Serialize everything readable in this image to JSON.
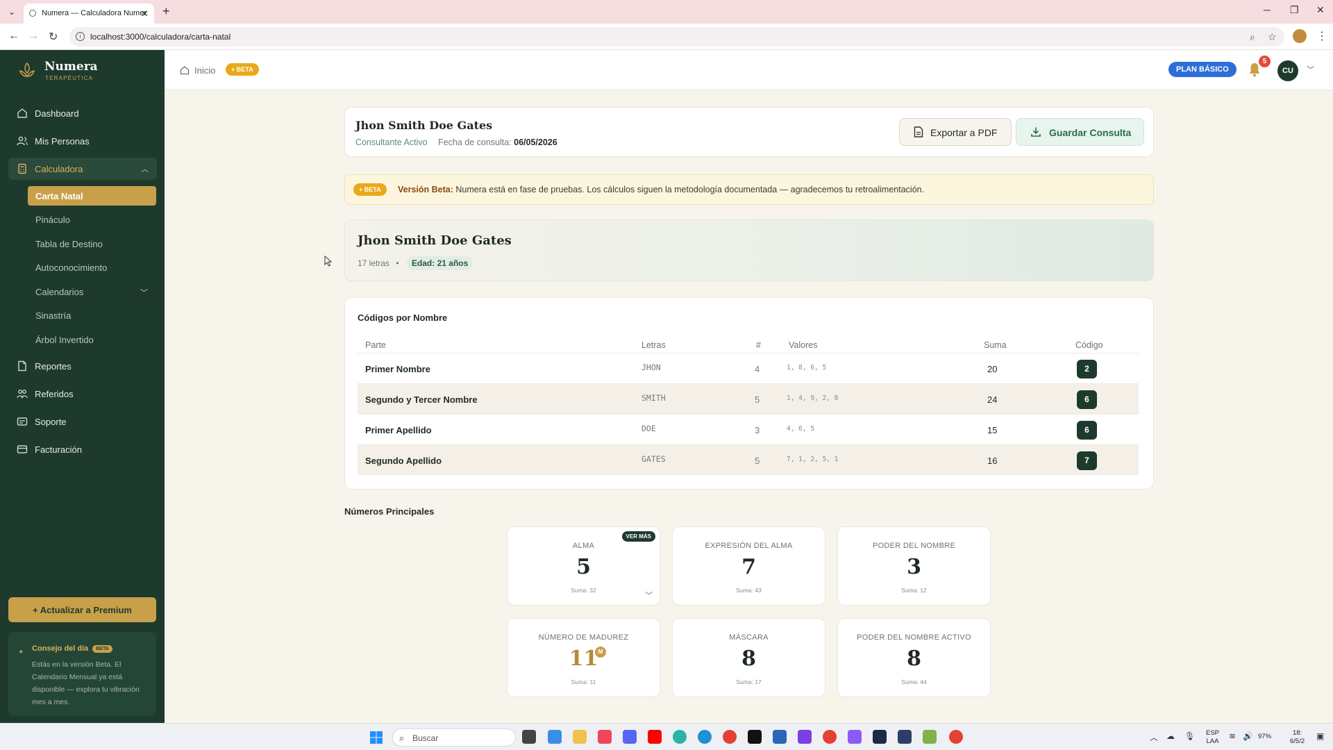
{
  "browser": {
    "tab_title": "Numera — Calculadora Numer",
    "url": "localhost:3000/calculadora/carta-natal"
  },
  "brand": {
    "name": "Numera",
    "subtitle": "Terapéutica"
  },
  "sidebar": {
    "items": [
      {
        "label": "Dashboard",
        "icon": "home-icon"
      },
      {
        "label": "Mis Personas",
        "icon": "users-icon"
      },
      {
        "label": "Calculadora",
        "icon": "calculator-icon"
      },
      {
        "label": "Reportes",
        "icon": "document-icon"
      },
      {
        "label": "Referidos",
        "icon": "referrals-icon"
      },
      {
        "label": "Soporte",
        "icon": "support-icon"
      },
      {
        "label": "Facturación",
        "icon": "billing-icon"
      }
    ],
    "calculadora_sub": [
      {
        "label": "Carta Natal"
      },
      {
        "label": "Pináculo"
      },
      {
        "label": "Tabla de Destino"
      },
      {
        "label": "Autoconocimiento"
      },
      {
        "label": "Calendarios"
      },
      {
        "label": "Sinastría"
      },
      {
        "label": "Árbol Invertido"
      }
    ],
    "premium_label": "+ Actualizar a Premium",
    "tip": {
      "title": "Consejo del día",
      "badge": "BETA",
      "text": "Estás en la versión Beta. El Calendario Mensual ya está disponible — explora tu vibración mes a mes."
    }
  },
  "header": {
    "breadcrumb_home": "Inicio",
    "beta_badge": "+ BETA",
    "plan_badge": "PLAN BÁSICO",
    "notifications_count": "5",
    "avatar_initials": "CU"
  },
  "client": {
    "name": "Jhon Smith Doe Gates",
    "status": "Consultante Activo",
    "date_label": "Fecha de consulta:",
    "date_value": "06/05/2026",
    "export_label": "Exportar a PDF",
    "save_label": "Guardar Consulta"
  },
  "beta_banner": {
    "pill": "+ BETA",
    "title": "Versión Beta:",
    "text": "Numera está en fase de pruebas. Los cálculos siguen la metodología documentada — agradecemos tu retroalimentación."
  },
  "hero": {
    "name": "Jhon Smith Doe Gates",
    "letters": "17 letras",
    "separator": "•",
    "age": "Edad: 21 años"
  },
  "codes": {
    "title": "Códigos por Nombre",
    "headers": {
      "parte": "Parte",
      "letras": "Letras",
      "num": "#",
      "valores": "Valores",
      "suma": "Suma",
      "codigo": "Código"
    },
    "rows": [
      {
        "parte": "Primer Nombre",
        "letras": "JHON",
        "num": "4",
        "valores": "1, 8, 6, 5",
        "suma": "20",
        "codigo": "2"
      },
      {
        "parte": "Segundo y Tercer Nombre",
        "letras": "SMITH",
        "num": "5",
        "valores": "1, 4, 9, 2, 8",
        "suma": "24",
        "codigo": "6"
      },
      {
        "parte": "Primer Apellido",
        "letras": "DOE",
        "num": "3",
        "valores": "4, 6, 5",
        "suma": "15",
        "codigo": "6"
      },
      {
        "parte": "Segundo Apellido",
        "letras": "GATES",
        "num": "5",
        "valores": "7, 1, 2, 5, 1",
        "suma": "16",
        "codigo": "7"
      }
    ]
  },
  "numeros": {
    "title": "Números Principales",
    "ver_mas": "VER MÁS",
    "master_badge": "M",
    "cards": [
      {
        "label": "Alma",
        "value": "5",
        "sum": "Suma: 32"
      },
      {
        "label": "Expresión del Alma",
        "value": "7",
        "sum": "Suma: 43"
      },
      {
        "label": "Poder del Nombre",
        "value": "3",
        "sum": "Suma: 12"
      },
      {
        "label": "Número de Madurez",
        "value": "11",
        "sum": "Suma: 11"
      },
      {
        "label": "Máscara",
        "value": "8",
        "sum": "Suma: 17"
      },
      {
        "label": "Poder del Nombre Activo",
        "value": "8",
        "sum": "Suma: 44"
      }
    ]
  },
  "taskbar": {
    "search_placeholder": "Buscar",
    "lang_line1": "ESP",
    "lang_line2": "LAA",
    "battery": "97%",
    "time": "18:",
    "date": "6/5/2"
  }
}
